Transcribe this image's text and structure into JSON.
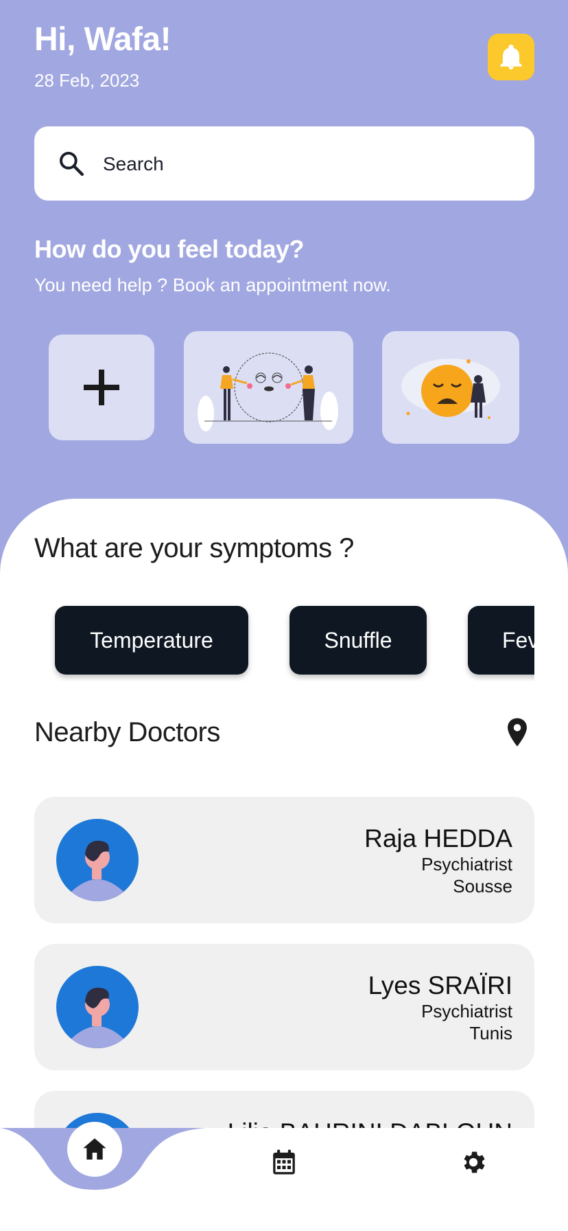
{
  "header": {
    "greeting": "Hi, Wafa!",
    "date": "28 Feb, 2023",
    "bell_icon": "bell-icon"
  },
  "search": {
    "placeholder": "Search",
    "icon": "search-icon"
  },
  "mood": {
    "title": "How do you feel today?",
    "subtitle": "You need help ? Book an appointment now.",
    "add_icon": "plus-icon"
  },
  "symptoms": {
    "title": "What are your symptoms ?",
    "chips": [
      "Temperature",
      "Snuffle",
      "Fever"
    ]
  },
  "nearby": {
    "title": "Nearby Doctors",
    "location_icon": "location-pin-icon",
    "doctors": [
      {
        "name": "Raja HEDDA",
        "specialty": "Psychiatrist",
        "city": "Sousse"
      },
      {
        "name": "Lyes SRAÏRI",
        "specialty": "Psychiatrist",
        "city": "Tunis"
      },
      {
        "name": "Lilia BAHRINI DABLOUN",
        "specialty": "",
        "city": ""
      }
    ]
  },
  "nav": {
    "items": [
      "home-icon",
      "calendar-icon",
      "settings-icon"
    ],
    "active": "home-icon"
  },
  "colors": {
    "header_bg": "#a1a7e0",
    "bell_bg": "#fbc92c",
    "chip_bg": "#0e1722",
    "card_bg": "#f0f0f0",
    "mood_card_bg": "#dcdef4"
  }
}
